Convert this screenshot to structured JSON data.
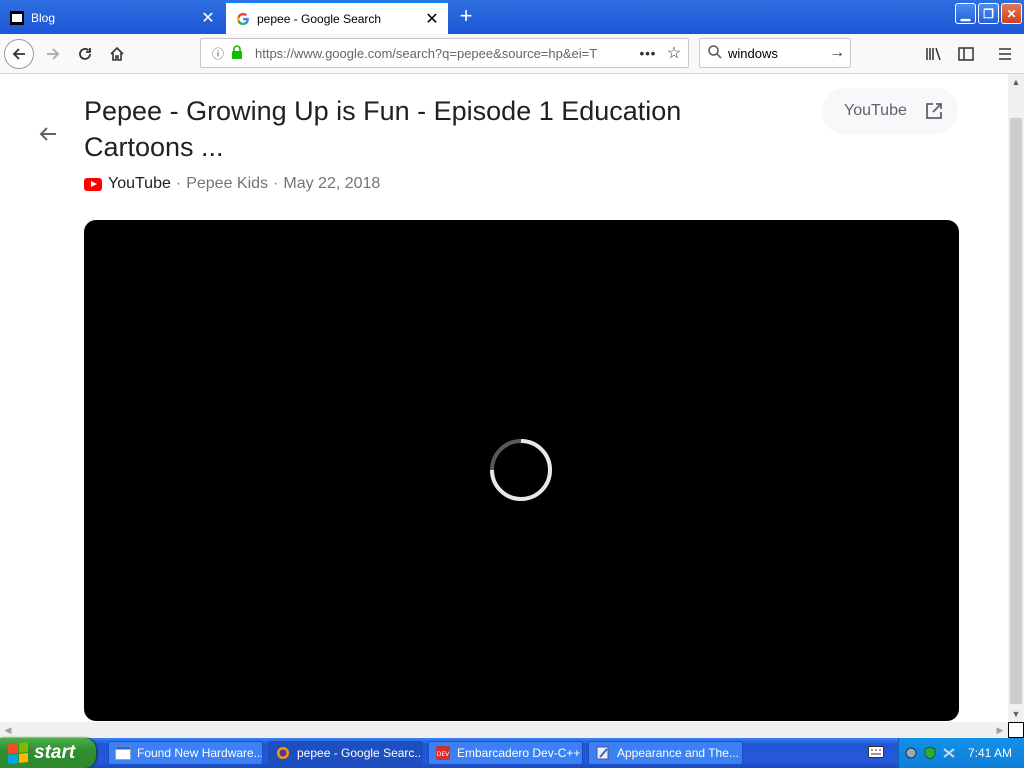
{
  "tabs": [
    {
      "title": "Blog",
      "active": false
    },
    {
      "title": "pepee - Google Search",
      "active": true
    }
  ],
  "nav": {
    "url": "https://www.google.com/search?q=pepee&source=hp&ei=T",
    "search_value": "windows"
  },
  "result": {
    "title": "Pepee - Growing Up is Fun - Episode 1 Education Cartoons ...",
    "chip_label": "YouTube",
    "source": "YouTube",
    "channel": "Pepee Kids",
    "date": "May 22, 2018",
    "sep": "·"
  },
  "taskbar": {
    "start_label": "start",
    "tasks": [
      {
        "label": "Found New Hardware...",
        "active": false
      },
      {
        "label": "pepee - Google Searc...",
        "active": true
      },
      {
        "label": "Embarcadero Dev-C++",
        "active": false
      },
      {
        "label": "Appearance and The...",
        "active": false
      }
    ],
    "clock": "7:41 AM"
  },
  "colors": {
    "accent": "#0a84ff",
    "taskbar": "#2458d8",
    "start": "#2f8f2f",
    "youtube_red": "#ff0000"
  }
}
